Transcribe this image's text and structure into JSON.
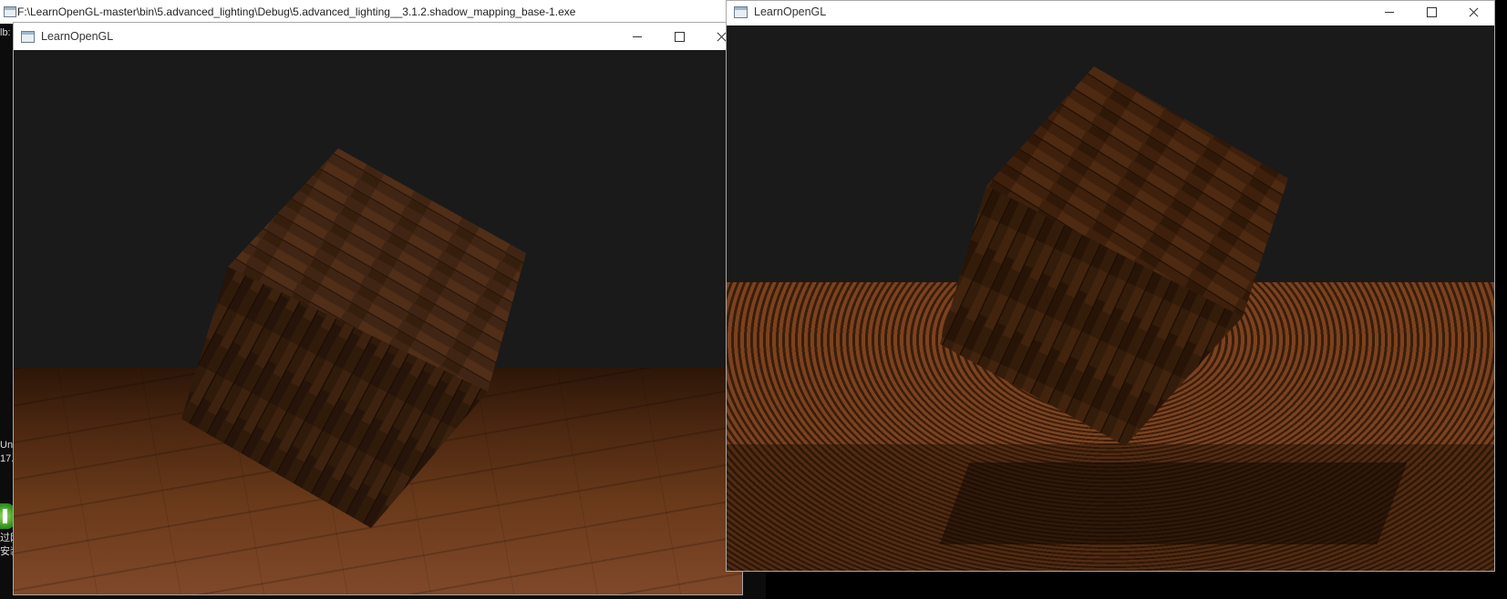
{
  "console": {
    "title": "F:\\LearnOpenGL-master\\bin\\5.advanced_lighting\\Debug\\5.advanced_lighting__3.1.2.shadow_mapping_base-1.exe",
    "lines": [
      "lb:",
      "Un",
      "17.",
      "过网",
      "安装"
    ]
  },
  "window_left": {
    "title": "LearnOpenGL",
    "controls": [
      "minimize",
      "maximize",
      "close"
    ],
    "scene": {
      "clear_color": "#1a1a1a",
      "floor_color": "#6a3a1a",
      "cube_color": "#3a2010"
    }
  },
  "window_right": {
    "title": "LearnOpenGL",
    "controls": [
      "minimize",
      "maximize",
      "close"
    ],
    "scene": {
      "clear_color": "#1a1a1a",
      "floor_color": "#7a4220",
      "artifact": "shadow acne"
    }
  }
}
